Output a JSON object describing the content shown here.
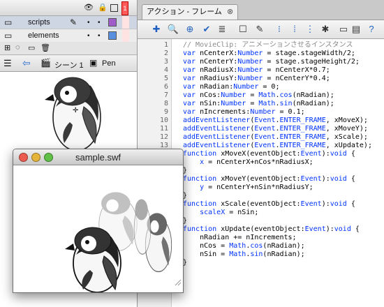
{
  "timeline": {
    "layers": [
      {
        "name": "scripts",
        "color": "#a05cc8"
      },
      {
        "name": "elements",
        "color": "#5a8fe0"
      }
    ],
    "frame_number": "1"
  },
  "scene_bar": {
    "scene": "シーン 1",
    "symbol": "Pen"
  },
  "actions_panel": {
    "tab_title": "アクション - フレーム",
    "line_numbers": [
      "1",
      "2",
      "3",
      "4",
      "5",
      "6",
      "7",
      "8",
      "9",
      "10",
      "11",
      "12",
      "13",
      "14",
      "15",
      "16",
      "17",
      "18",
      "19",
      "20",
      "21",
      "22",
      "23",
      "24",
      "25",
      "26",
      "27",
      "28",
      "29"
    ]
  },
  "swf_window": {
    "title": "sample.swf"
  },
  "icons": [
    "eye-icon",
    "lock-icon",
    "outline-square-icon",
    "pencil-icon",
    "add-statement-icon",
    "find-icon",
    "target-icon",
    "check-syntax-icon",
    "auto-format-icon",
    "code-hint-icon",
    "debug-icon",
    "collapse-icon",
    "expand-icon",
    "comment-icon",
    "help-icon",
    "back-arrow-icon",
    "scene-icon",
    "symbol-icon",
    "close-icon",
    "trash-icon"
  ]
}
